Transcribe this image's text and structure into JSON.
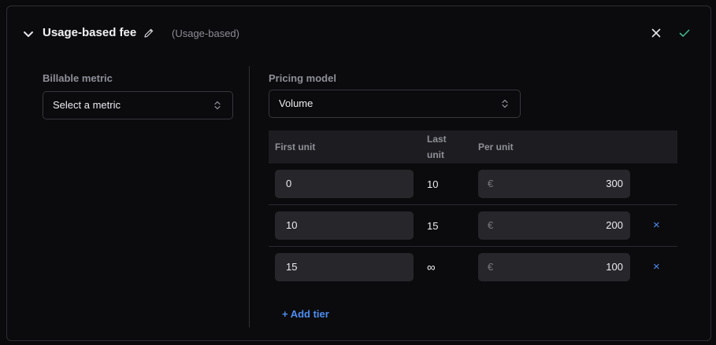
{
  "header": {
    "title": "Usage-based fee",
    "subtitle": "(Usage-based)",
    "chevron_icon": "chevron-down-icon",
    "edit_icon": "pencil-icon",
    "close_icon": "close-icon",
    "confirm_icon": "check-icon",
    "confirm_color": "#3fb98a"
  },
  "metric": {
    "label": "Billable metric",
    "value": "Select a metric"
  },
  "pricing": {
    "label": "Pricing model",
    "value": "Volume"
  },
  "tiers_table": {
    "headers": {
      "first_unit": "First unit",
      "last_unit_line1": "Last",
      "last_unit_line2": "unit",
      "per_unit": "Per unit"
    },
    "rows": [
      {
        "first_unit": "0",
        "last_unit": "10",
        "currency": "€",
        "per_unit": "300",
        "removable": false
      },
      {
        "first_unit": "10",
        "last_unit": "15",
        "currency": "€",
        "per_unit": "200",
        "removable": true,
        "remove_label": "×"
      },
      {
        "first_unit": "15",
        "last_unit": "∞",
        "currency": "€",
        "per_unit": "100",
        "removable": true,
        "remove_label": "×"
      }
    ]
  },
  "add_tier_label": "+ Add tier",
  "accent_color": "#4d8ef0"
}
